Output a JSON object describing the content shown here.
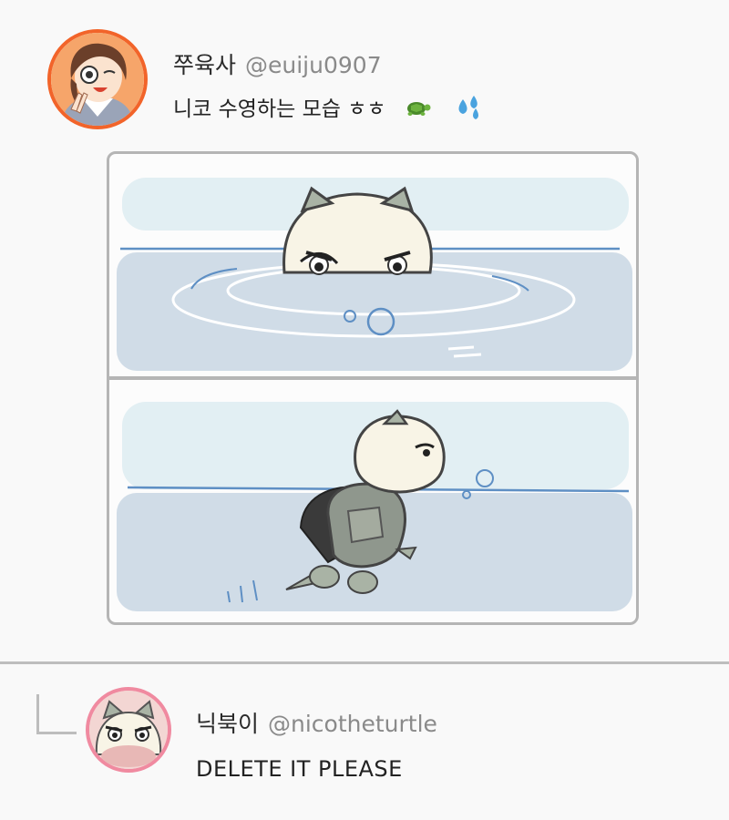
{
  "post": {
    "author_name": "쭈육사",
    "author_handle": "@euiju0907",
    "text": "니코 수영하는 모습 ㅎㅎ",
    "emojis": [
      "turtle-icon",
      "sweat-droplets-icon"
    ],
    "avatar_border_color": "#f2642a"
  },
  "reply": {
    "author_name": "닉북이",
    "author_handle": "@nicotheturtle",
    "text": "DELETE IT PLEASE",
    "avatar_border_color": "#f08aa0"
  }
}
